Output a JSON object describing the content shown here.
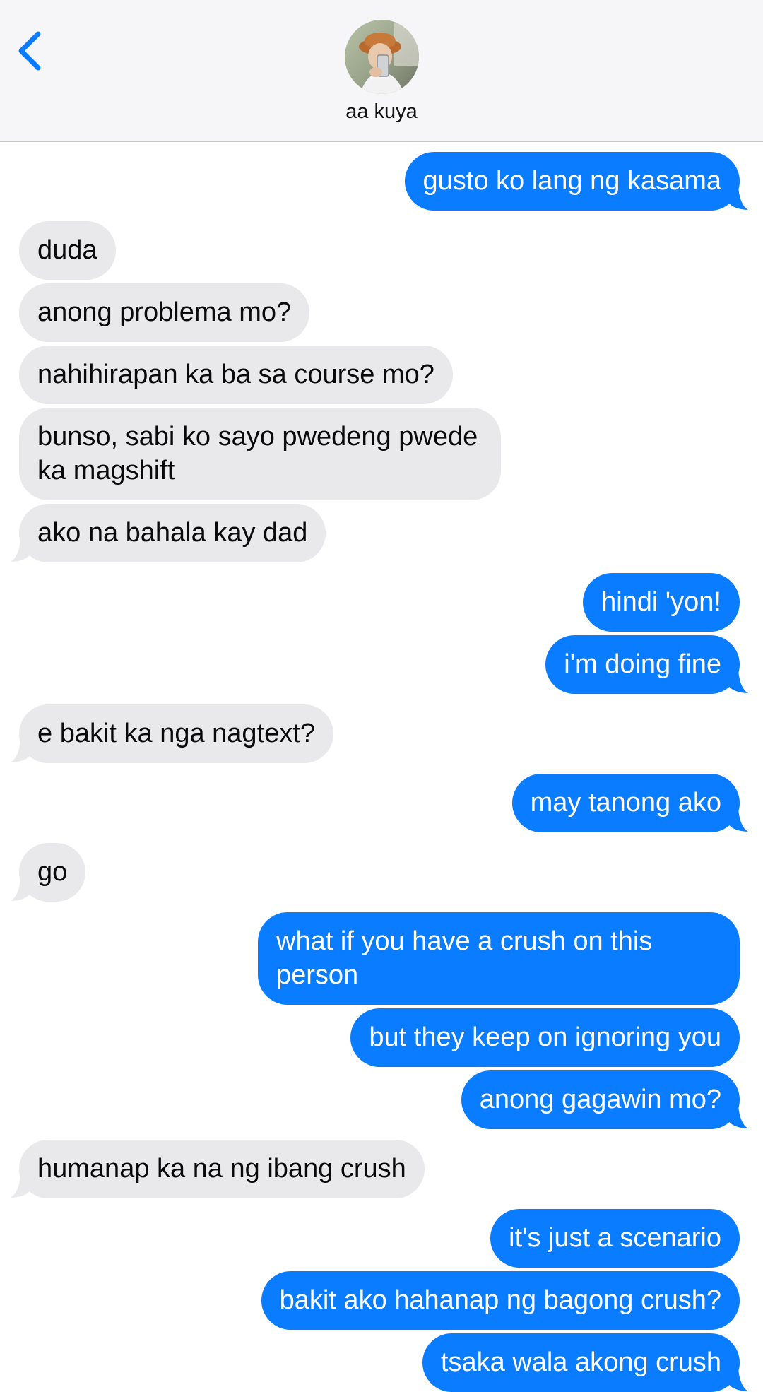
{
  "header": {
    "contact_name": "aa kuya",
    "back_icon": "chevron-left-icon",
    "avatar": "contact-avatar-photo"
  },
  "colors": {
    "sent_bubble": "#0a7cff",
    "received_bubble": "#e9e9eb",
    "accent": "#0a7cff"
  },
  "messages": [
    {
      "from": "me",
      "text": "gusto ko lang ng kasama",
      "tail": true
    },
    {
      "from": "them",
      "text": "duda",
      "tail": false
    },
    {
      "from": "them",
      "text": "anong problema mo?",
      "tail": false
    },
    {
      "from": "them",
      "text": "nahihirapan ka ba sa course mo?",
      "tail": false
    },
    {
      "from": "them",
      "text": "bunso, sabi ko sayo pwedeng pwede ka magshift",
      "tail": false
    },
    {
      "from": "them",
      "text": "ako na bahala kay dad",
      "tail": true
    },
    {
      "from": "me",
      "text": "hindi 'yon!",
      "tail": false
    },
    {
      "from": "me",
      "text": "i'm doing fine",
      "tail": true
    },
    {
      "from": "them",
      "text": "e bakit ka nga nagtext?",
      "tail": true
    },
    {
      "from": "me",
      "text": "may tanong ako",
      "tail": true
    },
    {
      "from": "them",
      "text": "go",
      "tail": true
    },
    {
      "from": "me",
      "text": "what if you have a crush on this person",
      "tail": false
    },
    {
      "from": "me",
      "text": "but they keep on ignoring you",
      "tail": false
    },
    {
      "from": "me",
      "text": "anong gagawin mo?",
      "tail": true
    },
    {
      "from": "them",
      "text": "humanap ka na ng ibang crush",
      "tail": true
    },
    {
      "from": "me",
      "text": "it's just a scenario",
      "tail": false
    },
    {
      "from": "me",
      "text": "bakit ako hahanap ng bagong crush?",
      "tail": false
    },
    {
      "from": "me",
      "text": "tsaka wala akong crush",
      "tail": true
    }
  ]
}
